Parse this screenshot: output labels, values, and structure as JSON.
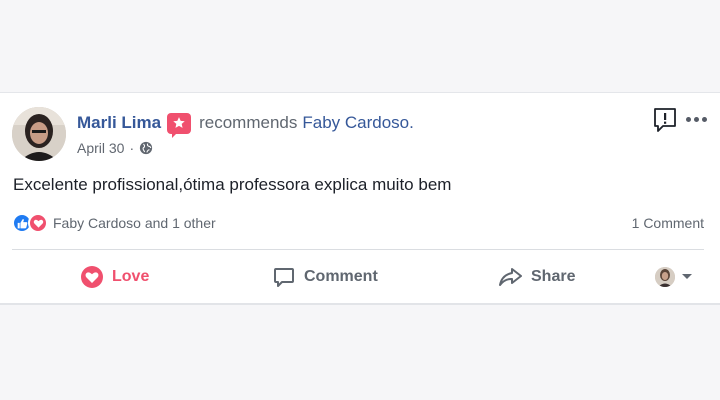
{
  "post": {
    "author": "Marli Lima",
    "recommends_text": "recommends",
    "recommended_page": "Faby Cardoso.",
    "date": "April 30",
    "separator": "·",
    "body": "Excelente profissional,ótima professora explica muito bem",
    "reactions_text": "Faby Cardoso and 1 other",
    "comment_count": "1 Comment"
  },
  "actions": {
    "love": "Love",
    "comment": "Comment",
    "share": "Share"
  },
  "icons": {
    "privacy": "globe-icon",
    "report": "report-icon",
    "more": "more-options-icon",
    "badge": "recommendation-star-icon"
  },
  "colors": {
    "link": "#365899",
    "love": "#f0506e",
    "like": "#1f7bf2",
    "muted": "#606770"
  }
}
